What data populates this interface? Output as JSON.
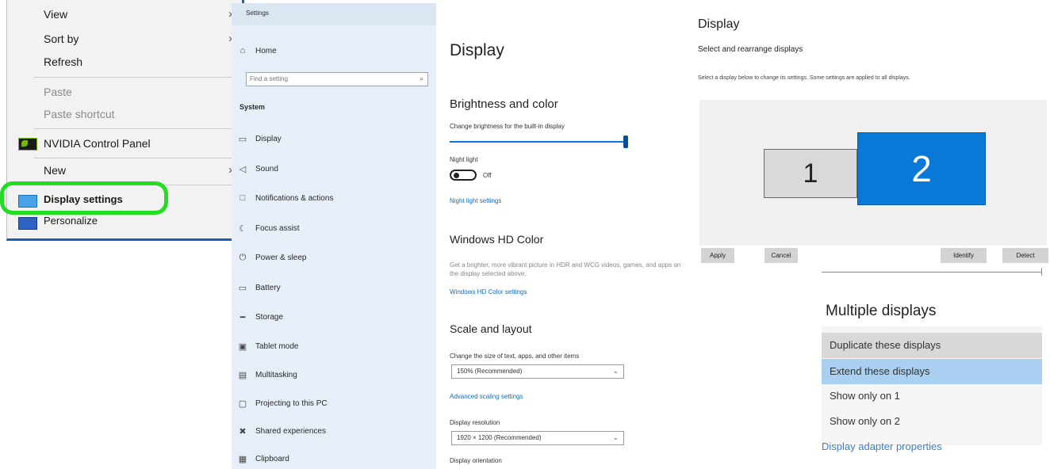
{
  "context_menu": {
    "items": [
      {
        "label": "View",
        "disabled": false,
        "submenu": true
      },
      {
        "label": "Sort by",
        "disabled": false,
        "submenu": true
      },
      {
        "label": "Refresh",
        "disabled": false,
        "submenu": false
      },
      {
        "label": "Paste",
        "disabled": true,
        "submenu": false
      },
      {
        "label": "Paste shortcut",
        "disabled": true,
        "submenu": false
      },
      {
        "label": "NVIDIA Control Panel",
        "disabled": false,
        "submenu": false,
        "icon": "nvidia-icon"
      },
      {
        "label": "New",
        "disabled": false,
        "submenu": true
      },
      {
        "label": "Display settings",
        "disabled": false,
        "submenu": false,
        "icon": "display-icon",
        "highlighted": true
      },
      {
        "label": "Personalize",
        "disabled": false,
        "submenu": false,
        "icon": "personalize-icon"
      }
    ],
    "highlight_color": "#22dd22"
  },
  "settings": {
    "window_title": "Settings",
    "home_label": "Home",
    "search_placeholder": "Find a setting",
    "section_label": "System",
    "nav_items": [
      {
        "label": "Display",
        "icon": "monitor-icon"
      },
      {
        "label": "Sound",
        "icon": "speaker-icon"
      },
      {
        "label": "Notifications & actions",
        "icon": "notification-icon"
      },
      {
        "label": "Focus assist",
        "icon": "moon-icon"
      },
      {
        "label": "Power & sleep",
        "icon": "power-icon"
      },
      {
        "label": "Battery",
        "icon": "battery-icon"
      },
      {
        "label": "Storage",
        "icon": "storage-icon"
      },
      {
        "label": "Tablet mode",
        "icon": "tablet-icon"
      },
      {
        "label": "Multitasking",
        "icon": "multitask-icon"
      },
      {
        "label": "Projecting to this PC",
        "icon": "project-icon"
      },
      {
        "label": "Shared experiences",
        "icon": "share-icon"
      },
      {
        "label": "Clipboard",
        "icon": "clipboard-icon"
      }
    ]
  },
  "display_panel": {
    "title": "Display",
    "brightness_heading": "Brightness and color",
    "brightness_label": "Change brightness for the built-in display",
    "brightness_value": 100,
    "night_light_label": "Night light",
    "night_light_state": "Off",
    "night_light_settings": "Night light settings",
    "hd_heading": "Windows HD Color",
    "hd_desc": "Get a brighter, more vibrant picture in HDR and WCG videos, games, and apps on the display selected above.",
    "hd_link": "Windows HD Color settings",
    "scale_heading": "Scale and layout",
    "scale_label": "Change the size of text, apps, and other items",
    "scale_value": "150% (Recommended)",
    "advanced_scaling": "Advanced scaling settings",
    "resolution_label": "Display resolution",
    "resolution_value": "1920 × 1200 (Recommended)",
    "orientation_label": "Display orientation"
  },
  "arrange_panel": {
    "title": "Display",
    "subtitle": "Select and rearrange displays",
    "desc": "Select a display below to change its settings. Some settings are applied to all displays.",
    "monitor_1": "1",
    "monitor_2": "2",
    "apply_label": "Apply",
    "cancel_label": "Cancel",
    "identify_label": "Identify",
    "detect_label": "Detect",
    "multiple_heading": "Multiple displays",
    "options": [
      "Duplicate these displays",
      "Extend these displays",
      "Show only on 1",
      "Show only on 2"
    ],
    "selected_option": "Extend these displays",
    "adapter_link": "Display adapter properties",
    "accent_color": "#0a78d7"
  }
}
